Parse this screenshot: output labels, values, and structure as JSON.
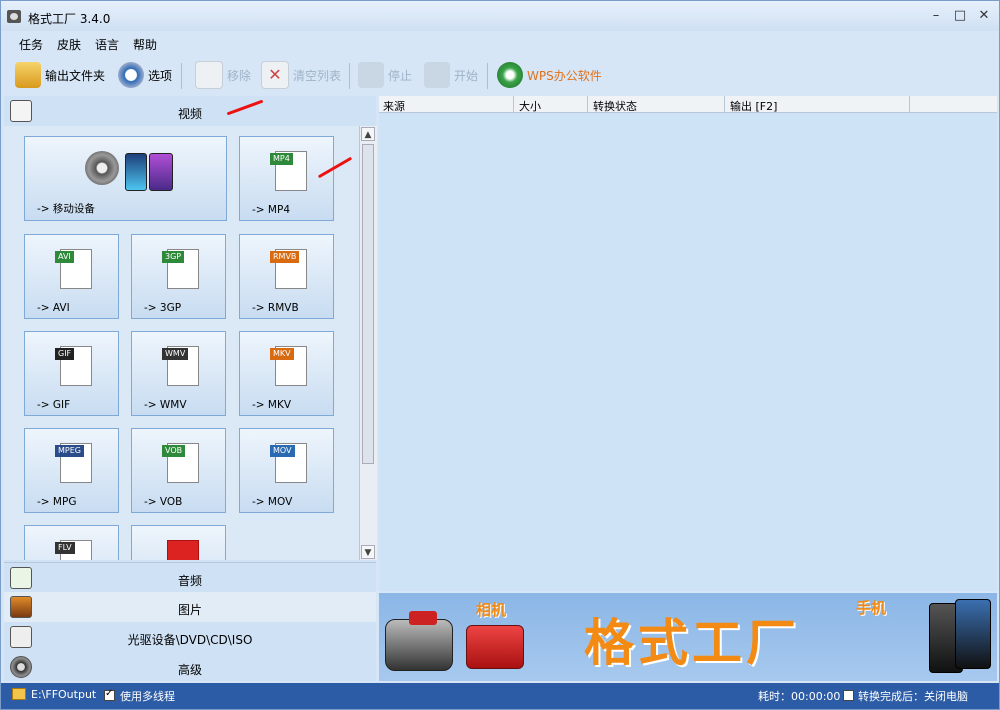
{
  "window": {
    "title": "格式工厂 3.4.0"
  },
  "menus": [
    "任务",
    "皮肤",
    "语言",
    "帮助"
  ],
  "toolbar": {
    "output_folder": "输出文件夹",
    "options": "选项",
    "remove": "移除",
    "clear_list": "清空列表",
    "stop": "停止",
    "start": "开始",
    "wps": "WPS办公软件"
  },
  "categories": {
    "video": "视频",
    "audio": "音频",
    "image": "图片",
    "rom": "光驱设备\\DVD\\CD\\ISO",
    "advanced": "高级"
  },
  "formats": [
    {
      "label": "-> 移动设备",
      "tag": "",
      "color": "#3a3a3a"
    },
    {
      "label": "-> MP4",
      "tag": "MP4",
      "color": "#2e8a3a"
    },
    {
      "label": "-> AVI",
      "tag": "AVI",
      "color": "#2e8a3a"
    },
    {
      "label": "-> 3GP",
      "tag": "3GP",
      "color": "#2e8a3a"
    },
    {
      "label": "-> RMVB",
      "tag": "RMVB",
      "color": "#d86a12"
    },
    {
      "label": "-> GIF",
      "tag": "GIF",
      "color": "#222"
    },
    {
      "label": "-> WMV",
      "tag": "WMV",
      "color": "#333"
    },
    {
      "label": "-> MKV",
      "tag": "MKV",
      "color": "#d86a12"
    },
    {
      "label": "-> MPG",
      "tag": "MPEG",
      "color": "#2a4c8a"
    },
    {
      "label": "-> VOB",
      "tag": "VOB",
      "color": "#2e8a3a"
    },
    {
      "label": "-> MOV",
      "tag": "MOV",
      "color": "#2a6ab0"
    },
    {
      "label": "",
      "tag": "FLV",
      "color": "#333"
    },
    {
      "label": "",
      "tag": "",
      "color": "#c22"
    }
  ],
  "list_columns": [
    "来源",
    "大小",
    "转换状态",
    "输出 [F2]"
  ],
  "banner": {
    "camera": "相机",
    "brand": "格式工厂",
    "phone": "手机"
  },
  "status": {
    "output_path": "E:\\FFOutput",
    "multithread": "使用多线程",
    "elapsed": "耗时：00:00:00",
    "after_complete": "转换完成后：关闭电脑"
  },
  "colors": {
    "accent": "#f28a14",
    "statusbar": "#2c5ca6",
    "panel": "#cfe1f4"
  }
}
